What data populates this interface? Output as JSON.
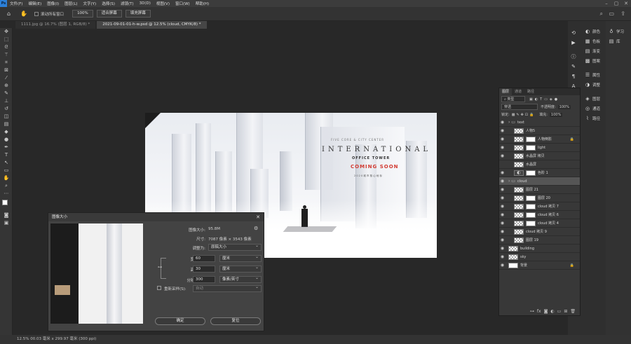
{
  "menu": [
    "文件(F)",
    "编辑(E)",
    "图像(I)",
    "图层(L)",
    "文字(Y)",
    "选择(S)",
    "滤镜(T)",
    "3D(D)",
    "视图(V)",
    "窗口(W)",
    "帮助(H)"
  ],
  "options_bar": {
    "scroll_all": "滚动所有窗口",
    "zoom": "100%",
    "fit_screen": "适合屏幕",
    "fill_screen": "填充屏幕"
  },
  "tabs": [
    "1111.jpg @ 16.7% (图层 1, RGB/8) *",
    "2021-09-01-01-h-w.psd @ 12.5% (cloud, CMYK/8) *"
  ],
  "status_bar": "12.5%   00.03 毫米 x 299.97 毫米 (300 ppi)",
  "poster": {
    "top_line": "FIVE CORE & CITY CENTER",
    "headline": "INTERNATIONAL",
    "sub": "OFFICE TOWER",
    "coming": "COMING SOON",
    "tiny": "2 0 2 0  城 市 核 心 地 标"
  },
  "right_dock": {
    "mid": [
      "颜色",
      "色板",
      "渐变",
      "图案",
      "属性",
      "调整",
      "图层",
      "通道",
      "路径"
    ],
    "right": [
      "学习",
      "库"
    ]
  },
  "layers_panel": {
    "tabs": [
      "图层",
      "通道",
      "路径"
    ],
    "kind": "类型",
    "blend": "穿透",
    "opacity_label": "不透明度:",
    "opacity": "100%",
    "lock_label": "锁定:",
    "fill_label": "填充:",
    "fill": "100%",
    "layers": [
      {
        "name": "text",
        "type": "folder",
        "eye": true
      },
      {
        "name": "人物5",
        "type": "layer",
        "eye": true
      },
      {
        "name": "人物倒影",
        "type": "masked",
        "eye": true,
        "lock": true
      },
      {
        "name": "light",
        "type": "masked",
        "eye": true
      },
      {
        "name": "水晶屏 拷贝",
        "type": "layer",
        "eye": true
      },
      {
        "name": "水晶屏",
        "type": "layer",
        "eye": false
      },
      {
        "name": "色阶 1",
        "type": "adjust",
        "eye": true
      },
      {
        "name": "cloud",
        "type": "folder",
        "eye": true,
        "selected": true
      },
      {
        "name": "图层 21",
        "type": "layer",
        "eye": true
      },
      {
        "name": "图层 20",
        "type": "masked",
        "eye": true
      },
      {
        "name": "cloud 拷贝 7",
        "type": "masked",
        "eye": true
      },
      {
        "name": "cloud 拷贝 6",
        "type": "masked",
        "eye": true
      },
      {
        "name": "cloud 拷贝 4",
        "type": "masked",
        "eye": true
      },
      {
        "name": "cloud 拷贝 9",
        "type": "layer",
        "eye": true
      },
      {
        "name": "图层 19",
        "type": "layer",
        "eye": true
      },
      {
        "name": "building",
        "type": "layer",
        "eye": true
      },
      {
        "name": "sky",
        "type": "layer",
        "eye": true
      },
      {
        "name": "背景",
        "type": "white",
        "eye": true,
        "lock": true
      }
    ]
  },
  "image_size_dialog": {
    "title": "图像大小",
    "size_label": "图像大小:",
    "size_value": "95.8M",
    "dims_label": "尺寸:",
    "dims_value": "7087 像素 × 3543 像素",
    "fit_label": "调整为:",
    "fit_value": "原稿大小",
    "width_label": "宽度(D):",
    "width_value": "60",
    "width_unit": "厘米",
    "height_label": "高度(G):",
    "height_value": "30",
    "height_unit": "厘米",
    "res_label": "分辨率(R):",
    "res_value": "300",
    "res_unit": "像素/英寸",
    "resample_label": "重新采样(S):",
    "resample_value": "自动",
    "ok": "确定",
    "reset": "复位"
  }
}
